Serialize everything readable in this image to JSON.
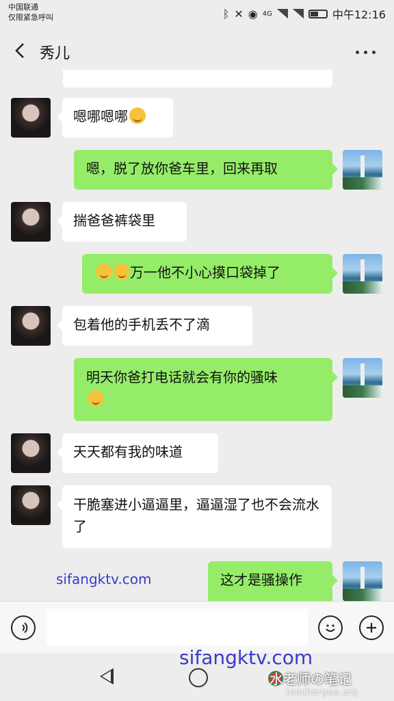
{
  "status_bar": {
    "carrier_line1": "中国联通",
    "carrier_line2": "仅限紧急呼叫",
    "network": "4G",
    "time": "中午12:16"
  },
  "header": {
    "title": "秀儿"
  },
  "messages": [
    {
      "from": "her",
      "text": "嗯哪嗯哪",
      "emoji": "smile-emoji"
    },
    {
      "from": "me",
      "text": "嗯，脱了放你爸车里，回来再取"
    },
    {
      "from": "her",
      "text": "揣爸爸裤袋里"
    },
    {
      "from": "me",
      "text": "万一他不小心摸口袋掉了",
      "emoji": "thinking-emoji"
    },
    {
      "from": "her",
      "text": "包着他的手机丢不了滴"
    },
    {
      "from": "me",
      "text": "明天你爸打电话就会有你的骚味",
      "emoji": "thinking-emoji"
    },
    {
      "from": "her",
      "text": "天天都有我的味道"
    },
    {
      "from": "her",
      "text": "干脆塞进小逼逼里，逼逼湿了也不会流水了"
    },
    {
      "from": "me",
      "text": "这才是骚操作"
    }
  ],
  "watermarks": {
    "site1": "sifangktv.com",
    "site2": "sifangktv.com",
    "brand": "水老师の笔记",
    "brand_url": "teachergua.org"
  },
  "colors": {
    "green_bubble": "#95ec69",
    "white_bubble": "#ffffff",
    "background": "#ededed",
    "watermark": "#3a3acb"
  },
  "icons": {
    "voice": "voice-icon",
    "emoji": "emoji-face-icon",
    "add": "plus-icon",
    "back": "back-arrow-icon",
    "more": "more-dots-icon"
  }
}
